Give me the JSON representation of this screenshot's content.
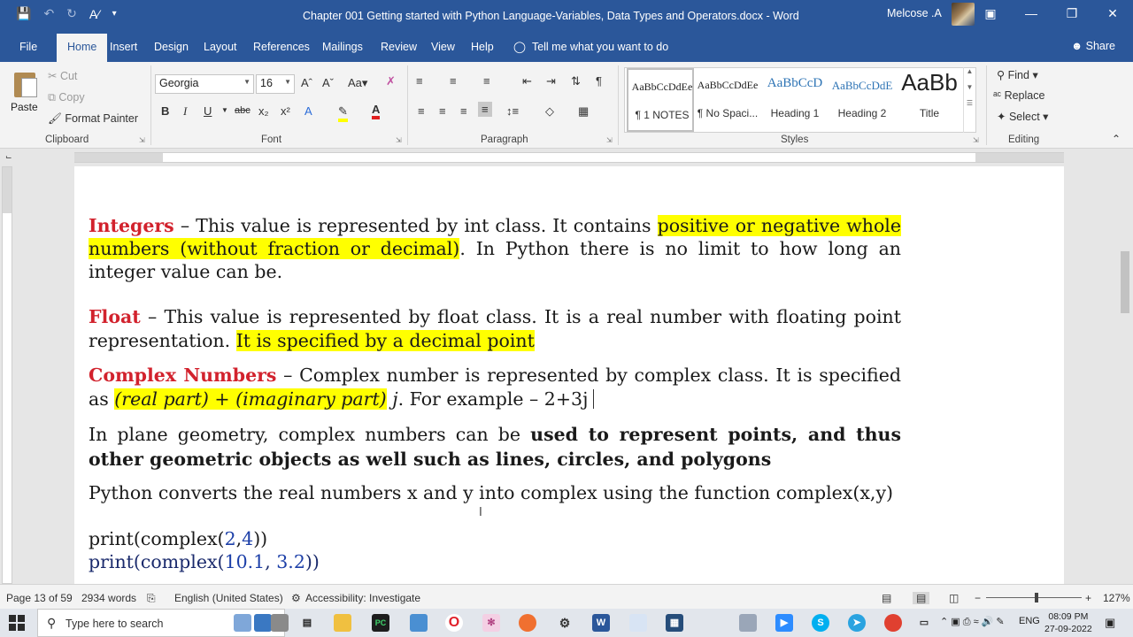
{
  "titlebar": {
    "doc_title": "Chapter 001  Getting started with Python Language-Variables, Data Types and Operators.docx  -  Word",
    "user": "Melcose .A",
    "accent": "#2b579a"
  },
  "tabs": [
    "File",
    "Home",
    "Insert",
    "Design",
    "Layout",
    "References",
    "Mailings",
    "Review",
    "View",
    "Help"
  ],
  "tell_me": "Tell me what you want to do",
  "share": "Share",
  "ribbon": {
    "clipboard": {
      "label": "Clipboard",
      "paste": "Paste",
      "cut": "Cut",
      "copy": "Copy",
      "format_painter": "Format Painter"
    },
    "font": {
      "label": "Font",
      "name": "Georgia",
      "size": "16"
    },
    "paragraph": {
      "label": "Paragraph"
    },
    "styles": {
      "label": "Styles",
      "items": [
        {
          "sample": "AaBbCcDdEe",
          "name": "¶ 1 NOTES"
        },
        {
          "sample": "AaBbCcDdEe",
          "name": "¶ No Spaci..."
        },
        {
          "sample": "AaBbCcD",
          "name": "Heading 1"
        },
        {
          "sample": "AaBbCcDdE",
          "name": "Heading 2"
        },
        {
          "sample": "AaBb",
          "name": "Title"
        }
      ]
    },
    "editing": {
      "label": "Editing",
      "find": "Find",
      "replace": "Replace",
      "select": "Select"
    }
  },
  "document": {
    "p1": {
      "term": "Integers",
      "a": " – This value is represented by int class. It contains ",
      "hl": "positive or negative whole numbers (without fraction or decimal)",
      "b": ". In Python there is no limit to how long an integer value can be."
    },
    "p2": {
      "term": "Float",
      "a": " – This value is represented by float class. It is a real number with floating point representation. ",
      "hl": "It is specified by a decimal point"
    },
    "p3": {
      "term": "Complex Numbers",
      "a": " – Complex number is represented by complex class. It is specified as ",
      "hl": "(real part) + (imaginary part)",
      "j": " j",
      "b": ". For example – 2+3j"
    },
    "p4": {
      "a": "In plane geometry, complex numbers can be ",
      "bold": "used to represent points, and thus other geometric objects as well such as lines, circles, and polygons"
    },
    "p5": "Python converts the real numbers x and y into complex using the function complex(x,y)",
    "code1": {
      "pre": "print(complex(",
      "n1": "2",
      "sep": ",",
      "n2": "4",
      "post": "))"
    },
    "code2": {
      "pre": "print(complex(",
      "n1": "10.1",
      "sep": ", ",
      "n2": "3.2",
      "post": "))"
    }
  },
  "status": {
    "page": "Page 13 of 59",
    "words": "2934 words",
    "language": "English (United States)",
    "accessibility": "Accessibility: Investigate",
    "zoom": "127%"
  },
  "taskbar": {
    "search_placeholder": "Type here to search",
    "lang": "ENG",
    "time": "08:09 PM",
    "date": "27-09-2022"
  }
}
